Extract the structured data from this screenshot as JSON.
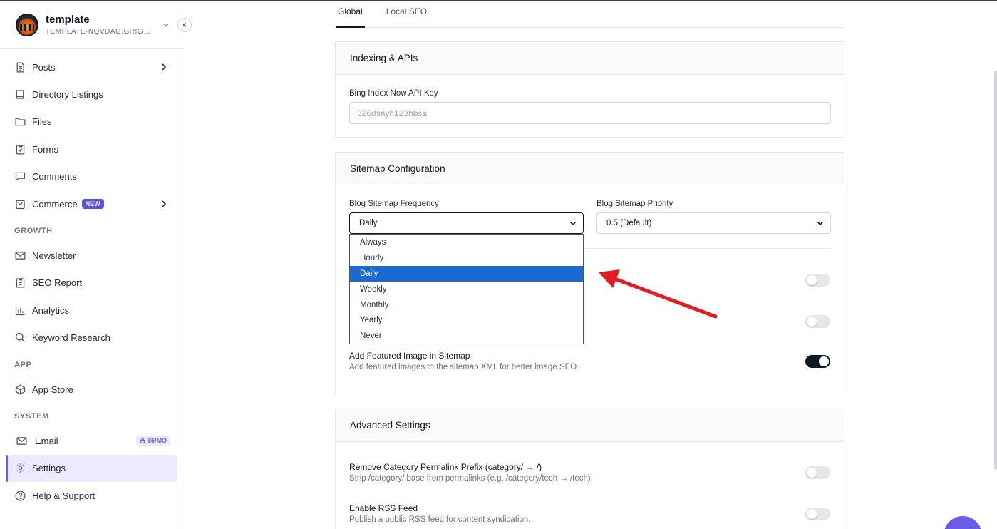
{
  "brand": {
    "name": "template",
    "domain": "TEMPLATE-NQVDAG.GRIGOR..."
  },
  "nav": {
    "primary": [
      {
        "label": "Posts",
        "icon": "document-icon",
        "has_chevron": true
      },
      {
        "label": "Directory Listings",
        "icon": "book-icon"
      },
      {
        "label": "Files",
        "icon": "folder-icon"
      },
      {
        "label": "Forms",
        "icon": "clipboard-icon"
      },
      {
        "label": "Comments",
        "icon": "comment-icon"
      },
      {
        "label": "Commerce",
        "icon": "shopping-bag-icon",
        "badge": "NEW",
        "has_chevron": true
      }
    ],
    "growth_label": "GROWTH",
    "growth": [
      {
        "label": "Newsletter",
        "icon": "mail-icon"
      },
      {
        "label": "SEO Report",
        "icon": "clipboard-icon"
      },
      {
        "label": "Analytics",
        "icon": "bar-chart-icon"
      },
      {
        "label": "Keyword Research",
        "icon": "search-icon"
      }
    ],
    "app_label": "APP",
    "app": [
      {
        "label": "App Store",
        "icon": "cube-icon"
      }
    ],
    "system_label": "SYSTEM",
    "system": [
      {
        "label": "Email",
        "icon": "mail-icon",
        "badge": "$5/MO"
      },
      {
        "label": "Settings",
        "icon": "gear-icon",
        "active": true
      },
      {
        "label": "Help & Support",
        "icon": "help-circle-icon"
      }
    ]
  },
  "tabs": [
    {
      "label": "Global",
      "active": true
    },
    {
      "label": "Local SEO"
    }
  ],
  "indexing": {
    "title": "Indexing & APIs",
    "bing_label": "Bing Index Now API Key",
    "bing_value": "326dsayh123hbsa"
  },
  "sitemap": {
    "title": "Sitemap Configuration",
    "frequency_label": "Blog Sitemap Frequency",
    "frequency_value": "Daily",
    "priority_label": "Blog Sitemap Priority",
    "priority_value": "0.5 (Default)",
    "frequency_options": [
      "Always",
      "Hourly",
      "Daily",
      "Weekly",
      "Monthly",
      "Yearly",
      "Never"
    ],
    "selected_option": "Daily",
    "featured_title": "Add Featured Image in Sitemap",
    "featured_desc": "Add featured images to the sitemap XML for better image SEO.",
    "toggle_states": [
      false,
      false,
      true
    ]
  },
  "advanced": {
    "title": "Advanced Settings",
    "remove_prefix_title": "Remove Category Permalink Prefix (category/ → /)",
    "remove_prefix_desc": "Strip /category/ base from permalinks (e.g. /category/tech → /tech).",
    "rss_title": "Enable RSS Feed",
    "rss_desc": "Publish a public RSS feed for content syndication.",
    "toggle_states": [
      false,
      false
    ]
  },
  "colors": {
    "accent": "#6d5ce8",
    "selected_option": "#1b6ad4",
    "arrow": "#e11d1d",
    "toggle_on": "#111827"
  }
}
